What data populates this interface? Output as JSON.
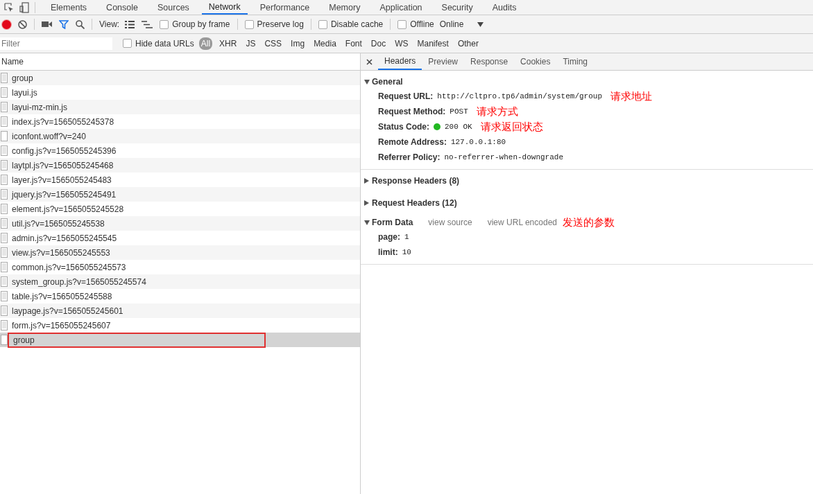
{
  "panel_tabs": [
    {
      "label": "Elements",
      "selected": false
    },
    {
      "label": "Console",
      "selected": false
    },
    {
      "label": "Sources",
      "selected": false
    },
    {
      "label": "Network",
      "selected": true
    },
    {
      "label": "Performance",
      "selected": false
    },
    {
      "label": "Memory",
      "selected": false
    },
    {
      "label": "Application",
      "selected": false
    },
    {
      "label": "Security",
      "selected": false
    },
    {
      "label": "Audits",
      "selected": false
    }
  ],
  "toolbar": {
    "recording": true,
    "filter_active": true,
    "view_label": "View:",
    "checkboxes": [
      {
        "label": "Group by frame",
        "checked": false
      },
      {
        "label": "Preserve log",
        "checked": false
      },
      {
        "label": "Disable cache",
        "checked": false
      },
      {
        "label": "Offline",
        "checked": false
      }
    ],
    "throttling": "Online"
  },
  "filter_bar": {
    "placeholder": "Filter",
    "hide_data_urls": {
      "label": "Hide data URLs",
      "checked": false
    },
    "types": [
      {
        "label": "All",
        "selected": true
      },
      {
        "label": "XHR",
        "selected": false
      },
      {
        "label": "JS",
        "selected": false
      },
      {
        "label": "CSS",
        "selected": false
      },
      {
        "label": "Img",
        "selected": false
      },
      {
        "label": "Media",
        "selected": false
      },
      {
        "label": "Font",
        "selected": false
      },
      {
        "label": "Doc",
        "selected": false
      },
      {
        "label": "WS",
        "selected": false
      },
      {
        "label": "Manifest",
        "selected": false
      },
      {
        "label": "Other",
        "selected": false
      }
    ]
  },
  "requests": {
    "column": "Name",
    "rows": [
      {
        "name": "group",
        "kind": "document",
        "selected": false,
        "outlined": false
      },
      {
        "name": "layui.js",
        "kind": "document",
        "selected": false,
        "outlined": false
      },
      {
        "name": "layui-mz-min.js",
        "kind": "document",
        "selected": false,
        "outlined": false
      },
      {
        "name": "index.js?v=1565055245378",
        "kind": "document",
        "selected": false,
        "outlined": false
      },
      {
        "name": "iconfont.woff?v=240",
        "kind": "blank",
        "selected": false,
        "outlined": false
      },
      {
        "name": "config.js?v=1565055245396",
        "kind": "document",
        "selected": false,
        "outlined": false
      },
      {
        "name": "laytpl.js?v=1565055245468",
        "kind": "document",
        "selected": false,
        "outlined": false
      },
      {
        "name": "layer.js?v=1565055245483",
        "kind": "document",
        "selected": false,
        "outlined": false
      },
      {
        "name": "jquery.js?v=1565055245491",
        "kind": "document",
        "selected": false,
        "outlined": false
      },
      {
        "name": "element.js?v=1565055245528",
        "kind": "document",
        "selected": false,
        "outlined": false
      },
      {
        "name": "util.js?v=1565055245538",
        "kind": "document",
        "selected": false,
        "outlined": false
      },
      {
        "name": "admin.js?v=1565055245545",
        "kind": "document",
        "selected": false,
        "outlined": false
      },
      {
        "name": "view.js?v=1565055245553",
        "kind": "document",
        "selected": false,
        "outlined": false
      },
      {
        "name": "common.js?v=1565055245573",
        "kind": "document",
        "selected": false,
        "outlined": false
      },
      {
        "name": "system_group.js?v=1565055245574",
        "kind": "document",
        "selected": false,
        "outlined": false
      },
      {
        "name": "table.js?v=1565055245588",
        "kind": "document",
        "selected": false,
        "outlined": false
      },
      {
        "name": "laypage.js?v=1565055245601",
        "kind": "document",
        "selected": false,
        "outlined": false
      },
      {
        "name": "form.js?v=1565055245607",
        "kind": "document",
        "selected": false,
        "outlined": false
      },
      {
        "name": "group",
        "kind": "blank",
        "selected": true,
        "outlined": true
      }
    ]
  },
  "detail_tabs": [
    {
      "label": "Headers",
      "selected": true
    },
    {
      "label": "Preview",
      "selected": false
    },
    {
      "label": "Response",
      "selected": false
    },
    {
      "label": "Cookies",
      "selected": false
    },
    {
      "label": "Timing",
      "selected": false
    }
  ],
  "general": {
    "title": "General",
    "expanded": true,
    "fields": [
      {
        "label": "Request URL:",
        "value": "http://cltpro.tp6/admin/system/group",
        "status_dot": false,
        "note": "请求地址"
      },
      {
        "label": "Request Method:",
        "value": "POST",
        "status_dot": false,
        "note": "请求方式"
      },
      {
        "label": "Status Code:",
        "value": "200 OK",
        "status_dot": true,
        "note": "请求返回状态"
      },
      {
        "label": "Remote Address:",
        "value": "127.0.0.1:80",
        "status_dot": false
      },
      {
        "label": "Referrer Policy:",
        "value": "no-referrer-when-downgrade",
        "status_dot": false
      }
    ]
  },
  "collapsed_sections": [
    {
      "title": "Response Headers (8)",
      "expanded": false
    },
    {
      "title": "Request Headers (12)",
      "expanded": false
    }
  ],
  "form_data": {
    "title": "Form Data",
    "expanded": true,
    "links": [
      "view source",
      "view URL encoded"
    ],
    "note": "发送的参数",
    "params": [
      {
        "name": "page:",
        "value": "1"
      },
      {
        "name": "limit:",
        "value": "10"
      }
    ]
  }
}
